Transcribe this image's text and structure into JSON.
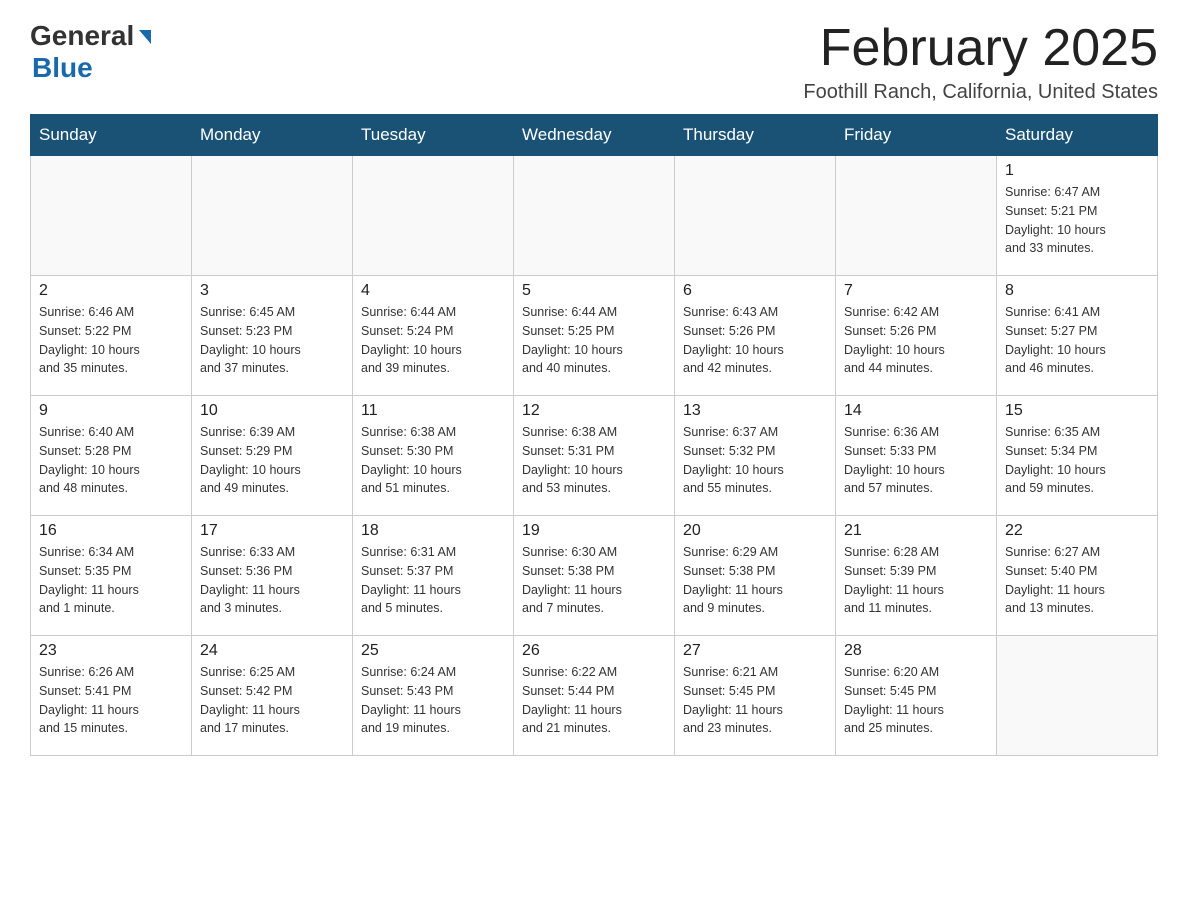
{
  "header": {
    "logo_general": "General",
    "logo_blue": "Blue",
    "title": "February 2025",
    "subtitle": "Foothill Ranch, California, United States"
  },
  "days_of_week": [
    "Sunday",
    "Monday",
    "Tuesday",
    "Wednesday",
    "Thursday",
    "Friday",
    "Saturday"
  ],
  "weeks": [
    [
      {
        "day": "",
        "info": ""
      },
      {
        "day": "",
        "info": ""
      },
      {
        "day": "",
        "info": ""
      },
      {
        "day": "",
        "info": ""
      },
      {
        "day": "",
        "info": ""
      },
      {
        "day": "",
        "info": ""
      },
      {
        "day": "1",
        "info": "Sunrise: 6:47 AM\nSunset: 5:21 PM\nDaylight: 10 hours\nand 33 minutes."
      }
    ],
    [
      {
        "day": "2",
        "info": "Sunrise: 6:46 AM\nSunset: 5:22 PM\nDaylight: 10 hours\nand 35 minutes."
      },
      {
        "day": "3",
        "info": "Sunrise: 6:45 AM\nSunset: 5:23 PM\nDaylight: 10 hours\nand 37 minutes."
      },
      {
        "day": "4",
        "info": "Sunrise: 6:44 AM\nSunset: 5:24 PM\nDaylight: 10 hours\nand 39 minutes."
      },
      {
        "day": "5",
        "info": "Sunrise: 6:44 AM\nSunset: 5:25 PM\nDaylight: 10 hours\nand 40 minutes."
      },
      {
        "day": "6",
        "info": "Sunrise: 6:43 AM\nSunset: 5:26 PM\nDaylight: 10 hours\nand 42 minutes."
      },
      {
        "day": "7",
        "info": "Sunrise: 6:42 AM\nSunset: 5:26 PM\nDaylight: 10 hours\nand 44 minutes."
      },
      {
        "day": "8",
        "info": "Sunrise: 6:41 AM\nSunset: 5:27 PM\nDaylight: 10 hours\nand 46 minutes."
      }
    ],
    [
      {
        "day": "9",
        "info": "Sunrise: 6:40 AM\nSunset: 5:28 PM\nDaylight: 10 hours\nand 48 minutes."
      },
      {
        "day": "10",
        "info": "Sunrise: 6:39 AM\nSunset: 5:29 PM\nDaylight: 10 hours\nand 49 minutes."
      },
      {
        "day": "11",
        "info": "Sunrise: 6:38 AM\nSunset: 5:30 PM\nDaylight: 10 hours\nand 51 minutes."
      },
      {
        "day": "12",
        "info": "Sunrise: 6:38 AM\nSunset: 5:31 PM\nDaylight: 10 hours\nand 53 minutes."
      },
      {
        "day": "13",
        "info": "Sunrise: 6:37 AM\nSunset: 5:32 PM\nDaylight: 10 hours\nand 55 minutes."
      },
      {
        "day": "14",
        "info": "Sunrise: 6:36 AM\nSunset: 5:33 PM\nDaylight: 10 hours\nand 57 minutes."
      },
      {
        "day": "15",
        "info": "Sunrise: 6:35 AM\nSunset: 5:34 PM\nDaylight: 10 hours\nand 59 minutes."
      }
    ],
    [
      {
        "day": "16",
        "info": "Sunrise: 6:34 AM\nSunset: 5:35 PM\nDaylight: 11 hours\nand 1 minute."
      },
      {
        "day": "17",
        "info": "Sunrise: 6:33 AM\nSunset: 5:36 PM\nDaylight: 11 hours\nand 3 minutes."
      },
      {
        "day": "18",
        "info": "Sunrise: 6:31 AM\nSunset: 5:37 PM\nDaylight: 11 hours\nand 5 minutes."
      },
      {
        "day": "19",
        "info": "Sunrise: 6:30 AM\nSunset: 5:38 PM\nDaylight: 11 hours\nand 7 minutes."
      },
      {
        "day": "20",
        "info": "Sunrise: 6:29 AM\nSunset: 5:38 PM\nDaylight: 11 hours\nand 9 minutes."
      },
      {
        "day": "21",
        "info": "Sunrise: 6:28 AM\nSunset: 5:39 PM\nDaylight: 11 hours\nand 11 minutes."
      },
      {
        "day": "22",
        "info": "Sunrise: 6:27 AM\nSunset: 5:40 PM\nDaylight: 11 hours\nand 13 minutes."
      }
    ],
    [
      {
        "day": "23",
        "info": "Sunrise: 6:26 AM\nSunset: 5:41 PM\nDaylight: 11 hours\nand 15 minutes."
      },
      {
        "day": "24",
        "info": "Sunrise: 6:25 AM\nSunset: 5:42 PM\nDaylight: 11 hours\nand 17 minutes."
      },
      {
        "day": "25",
        "info": "Sunrise: 6:24 AM\nSunset: 5:43 PM\nDaylight: 11 hours\nand 19 minutes."
      },
      {
        "day": "26",
        "info": "Sunrise: 6:22 AM\nSunset: 5:44 PM\nDaylight: 11 hours\nand 21 minutes."
      },
      {
        "day": "27",
        "info": "Sunrise: 6:21 AM\nSunset: 5:45 PM\nDaylight: 11 hours\nand 23 minutes."
      },
      {
        "day": "28",
        "info": "Sunrise: 6:20 AM\nSunset: 5:45 PM\nDaylight: 11 hours\nand 25 minutes."
      },
      {
        "day": "",
        "info": ""
      }
    ]
  ]
}
